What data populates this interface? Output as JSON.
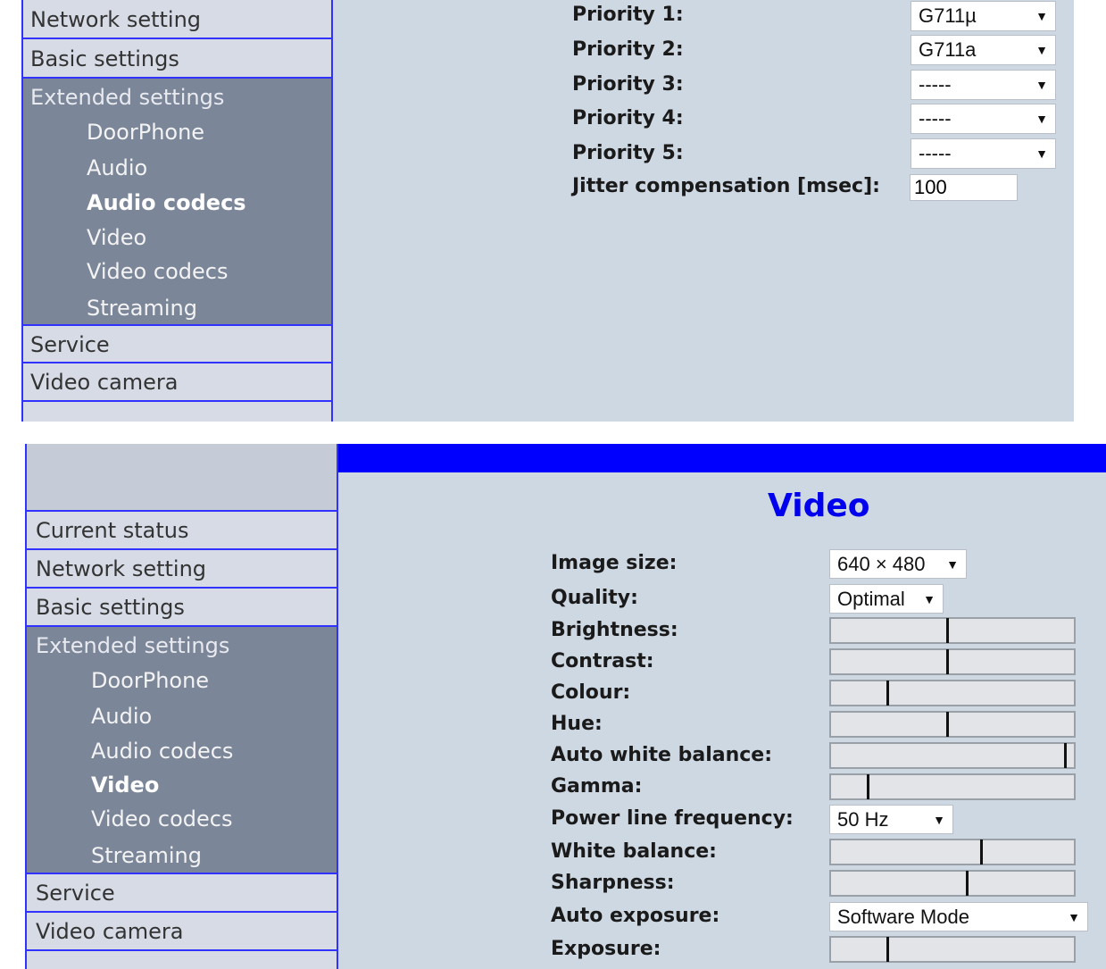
{
  "top_panel": {
    "sidebar": {
      "network_setting": "Network setting",
      "basic_settings": "Basic settings",
      "extended_settings": "Extended settings",
      "sub_items": [
        "DoorPhone",
        "Audio",
        "Audio codecs",
        "Video",
        "Video codecs",
        "Streaming"
      ],
      "selected": "Audio codecs",
      "service": "Service",
      "video_camera": "Video camera"
    },
    "codecs": {
      "priority1_label": "Priority 1:",
      "priority1_value": "G711µ",
      "priority2_label": "Priority 2:",
      "priority2_value": "G711a",
      "priority3_label": "Priority 3:",
      "priority3_value": "-----",
      "priority4_label": "Priority 4:",
      "priority4_value": "-----",
      "priority5_label": "Priority 5:",
      "priority5_value": "-----",
      "jitter_label": "Jitter compensation [msec]:",
      "jitter_value": "100"
    }
  },
  "bottom_panel": {
    "sidebar": {
      "current_status": "Current status",
      "network_setting": "Network setting",
      "basic_settings": "Basic settings",
      "extended_settings": "Extended settings",
      "sub_items": [
        "DoorPhone",
        "Audio",
        "Audio codecs",
        "Video",
        "Video codecs",
        "Streaming"
      ],
      "selected": "Video",
      "service": "Service",
      "video_camera": "Video camera"
    },
    "video": {
      "title": "Video",
      "image_size_label": "Image size:",
      "image_size_value": "640 × 480",
      "quality_label": "Quality:",
      "quality_value": "Optimal",
      "brightness_label": "Brightness:",
      "brightness_level": 0.48,
      "contrast_label": "Contrast:",
      "contrast_level": 0.48,
      "colour_label": "Colour:",
      "colour_level": 0.23,
      "hue_label": "Hue:",
      "hue_level": 0.48,
      "awb_label": "Auto white balance:",
      "awb_level": 0.97,
      "gamma_label": "Gamma:",
      "gamma_level": 0.15,
      "power_line_label": "Power line frequency:",
      "power_line_value": "50 Hz",
      "white_balance_label": "White balance:",
      "white_balance_level": 0.62,
      "sharpness_label": "Sharpness:",
      "sharpness_level": 0.56,
      "auto_exposure_label": "Auto exposure:",
      "auto_exposure_value": "Software Mode",
      "exposure_label": "Exposure:",
      "exposure_level": 0.23
    }
  },
  "colors": {
    "header_blue": "#0000ff",
    "content_bg": "#ced8e3",
    "sidebar_light": "#d6dbe6",
    "sidebar_dark": "#7b8699",
    "border_blue": "#3232ff"
  }
}
